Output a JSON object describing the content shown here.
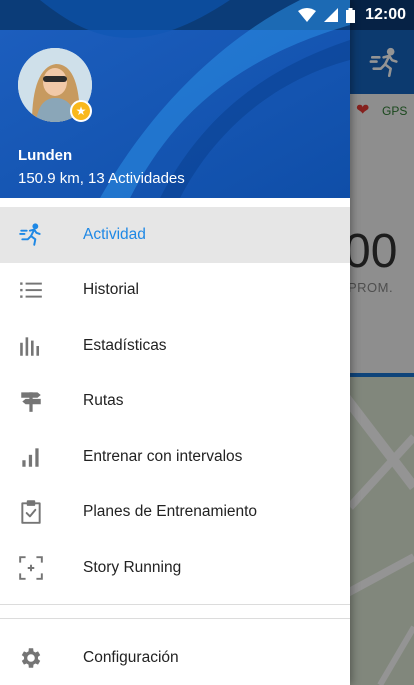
{
  "status_bar": {
    "time": "12:00"
  },
  "background_screen": {
    "big_value": "00",
    "big_value_caption": "PROM.",
    "gps_label": "GPS"
  },
  "drawer": {
    "user": {
      "name": "Lunden",
      "stats": "150.9 km, 13 Actividades"
    },
    "menu": [
      {
        "label": "Actividad",
        "icon": "running-icon",
        "active": true
      },
      {
        "label": "Historial",
        "icon": "list-icon",
        "active": false
      },
      {
        "label": "Estadísticas",
        "icon": "bar-chart-icon",
        "active": false
      },
      {
        "label": "Rutas",
        "icon": "signpost-icon",
        "active": false
      },
      {
        "label": "Entrenar con intervalos",
        "icon": "interval-bars-icon",
        "active": false
      },
      {
        "label": "Planes de Entrenamiento",
        "icon": "clipboard-check-icon",
        "active": false
      },
      {
        "label": "Story Running",
        "icon": "story-frame-icon",
        "active": false
      }
    ],
    "settings": {
      "label": "Configuración",
      "icon": "gear-icon"
    }
  },
  "colors": {
    "accent": "#1e88e5",
    "header_blue": "#1b5fc4",
    "active_row": "#e6e6e6",
    "icon_gray": "#757575",
    "badge_gold": "#f9b81c"
  }
}
